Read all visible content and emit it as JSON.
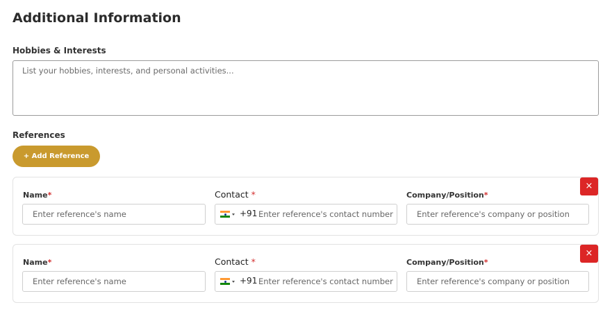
{
  "section": {
    "title": "Additional Information"
  },
  "hobbies": {
    "label": "Hobbies & Interests",
    "placeholder": "List your hobbies, interests, and personal activities...",
    "value": ""
  },
  "references": {
    "label": "References",
    "add_button_label": "+ Add Reference",
    "remove_icon": "×",
    "required_mark": "*",
    "items": [
      {
        "name_label": "Name",
        "name_placeholder": "Enter reference's name",
        "contact_label": "Contact",
        "dial_code": "+91",
        "contact_placeholder": "Enter reference's contact number",
        "company_label": "Company/Position",
        "company_placeholder": "Enter reference's company or position"
      },
      {
        "name_label": "Name",
        "name_placeholder": "Enter reference's name",
        "contact_label": "Contact",
        "dial_code": "+91",
        "contact_placeholder": "Enter reference's contact number",
        "company_label": "Company/Position",
        "company_placeholder": "Enter reference's company or position"
      }
    ]
  },
  "colors": {
    "accent": "#c99a2e",
    "danger": "#dc2626",
    "required": "#d32f2f"
  },
  "icons": {
    "flag": "india-flag-icon",
    "remove": "close-icon",
    "caret": "chevron-down-icon"
  }
}
